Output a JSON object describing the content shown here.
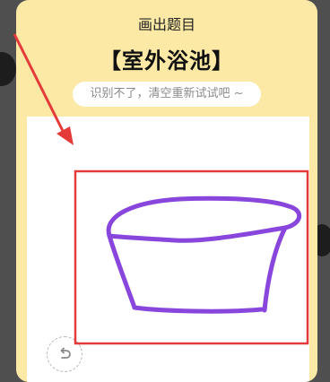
{
  "header": {
    "title": "画出题目"
  },
  "topic": {
    "text": "【室外浴池】"
  },
  "hint": {
    "text": "识别不了，清空重新试试吧 ~"
  },
  "canvas": {
    "stroke_color": "#8846dc"
  },
  "undo": {
    "icon": "undo-icon"
  },
  "annotation": {
    "color": "#e53a3a"
  }
}
